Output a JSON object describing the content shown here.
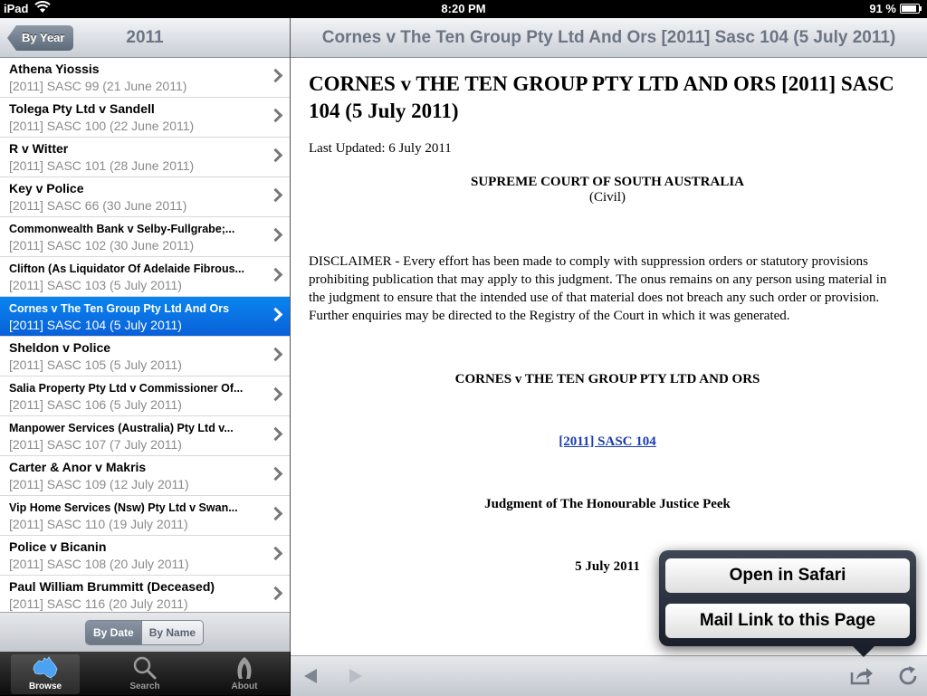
{
  "status": {
    "device": "iPad",
    "time": "8:20 PM",
    "battery": "91 %",
    "battery_level": 0.91
  },
  "left": {
    "back_label": "By Year",
    "title": "2011",
    "items": [
      {
        "title": "Athena Yiossis",
        "sub": "[2011] SASC 99 (21 June 2011)",
        "small": false
      },
      {
        "title": "Tolega Pty Ltd v Sandell",
        "sub": "[2011] SASC 100 (22 June 2011)",
        "small": false
      },
      {
        "title": "R v Witter",
        "sub": "[2011] SASC 101 (28 June 2011)",
        "small": false
      },
      {
        "title": "Key v Police",
        "sub": "[2011] SASC 66 (30 June 2011)",
        "small": false
      },
      {
        "title": "Commonwealth Bank v Selby-Fullgrabe;...",
        "sub": "[2011] SASC 102 (30 June 2011)",
        "small": true
      },
      {
        "title": "Clifton (As Liquidator Of Adelaide Fibrous...",
        "sub": "[2011] SASC 103 (5 July 2011)",
        "small": true
      },
      {
        "title": "Cornes v The Ten Group Pty Ltd And Ors",
        "sub": "[2011] SASC 104 (5 July 2011)",
        "small": true,
        "selected": true
      },
      {
        "title": "Sheldon v Police",
        "sub": "[2011] SASC 105 (5 July 2011)",
        "small": false
      },
      {
        "title": "Salia Property Pty Ltd v Commissioner Of...",
        "sub": "[2011] SASC 106 (5 July 2011)",
        "small": true
      },
      {
        "title": "Manpower Services (Australia) Pty Ltd v...",
        "sub": "[2011] SASC 107 (7 July 2011)",
        "small": true
      },
      {
        "title": "Carter & Anor v Makris",
        "sub": "[2011] SASC 109 (12 July 2011)",
        "small": false
      },
      {
        "title": "Vip Home Services (Nsw) Pty Ltd v Swan...",
        "sub": "[2011] SASC 110 (19 July 2011)",
        "small": true
      },
      {
        "title": "Police v Bicanin",
        "sub": "[2011] SASC 108 (20 July 2011)",
        "small": false
      },
      {
        "title": "Paul William Brummitt (Deceased)",
        "sub": "[2011] SASC 116 (20 July 2011)",
        "small": false
      }
    ],
    "segment": {
      "by_date": "By Date",
      "by_name": "By Name"
    }
  },
  "tabs": [
    {
      "label": "Browse",
      "icon": "australia-map-icon"
    },
    {
      "label": "Search",
      "icon": "magnifier-icon"
    },
    {
      "label": "About",
      "icon": "about-icon"
    }
  ],
  "right": {
    "title": "Cornes v The Ten Group Pty Ltd And Ors [2011] Sasc 104 (5 July 2011)",
    "doc": {
      "heading": "CORNES v THE TEN GROUP PTY LTD AND ORS [2011] SASC 104 (5 July 2011)",
      "updated": "Last Updated: 6 July 2011",
      "court": "SUPREME COURT OF SOUTH AUSTRALIA",
      "division": "(Civil)",
      "disclaimer": "DISCLAIMER - Every effort has been made to comply with suppression orders or statutory provisions prohibiting publication that may apply to this judgment. The onus remains on any person using material in the judgment to ensure that the intended use of that material does not breach any such order or provision. Further enquiries may be directed to the Registry of the Court in which it was generated.",
      "case_name": "CORNES v THE TEN GROUP PTY LTD AND ORS",
      "citation": "[2011] SASC 104",
      "judge": "Judgment of The Honourable Justice Peek",
      "date": "5 July 2011"
    }
  },
  "popover": {
    "open_safari": "Open in Safari",
    "mail_link": "Mail Link to this Page"
  }
}
